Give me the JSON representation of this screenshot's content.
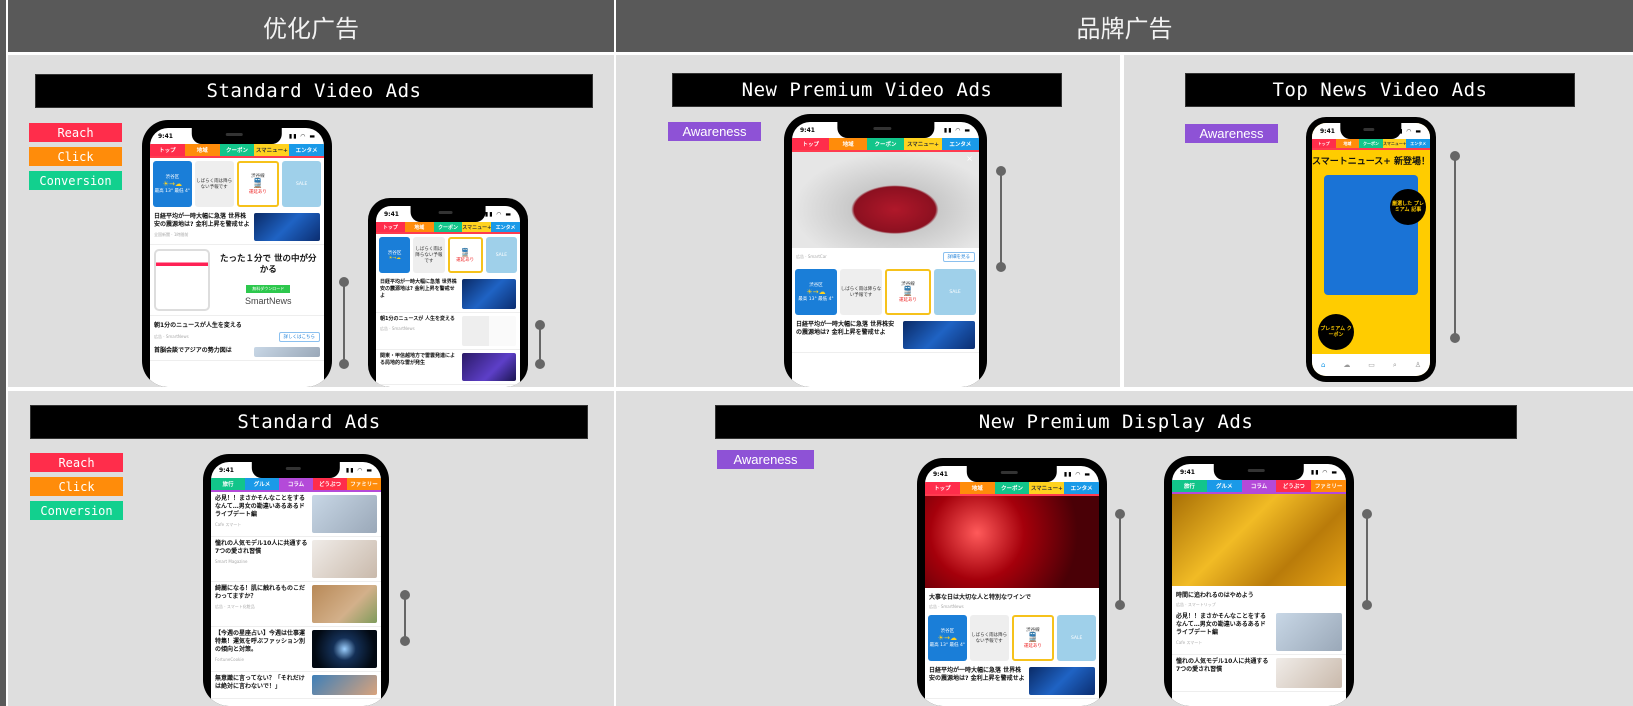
{
  "headers": {
    "optimized": "优化广告",
    "brand": "品牌广告"
  },
  "colors": {
    "reach": "#ff2d4b",
    "click": "#ff8c0a",
    "conversion": "#12d08e",
    "awareness": "#8e52d6",
    "header_bg": "#595959",
    "panel_bg": "#dedede"
  },
  "badges": {
    "reach": "Reach",
    "click": "Click",
    "conversion": "Conversion",
    "awareness": "Awareness"
  },
  "sections": {
    "standard_video": {
      "title": "Standard Video Ads"
    },
    "new_premium_video": {
      "title": "New Premium Video Ads"
    },
    "top_news_video": {
      "title": "Top News Video Ads"
    },
    "standard": {
      "title": "Standard Ads"
    },
    "new_premium_display": {
      "title": "New Premium Display Ads"
    }
  },
  "phone": {
    "time": "9:41",
    "status_icons": "▮▮ ◠ ▬",
    "tabs_main": [
      "トップ",
      "地域",
      "クーポン",
      "スマニュー+",
      "エンタメ"
    ],
    "tabs_alt": [
      "旅行",
      "グルメ",
      "コラム",
      "どうぶつ",
      "ファミリー"
    ],
    "cards": {
      "weather_area": "渋谷区",
      "weather_icon": "☀→☁",
      "weather_temps": "最高 13° 最低 4°",
      "map_text": "しばらく雨は降らない予報です",
      "train_station": "渋谷線",
      "train_icon": "🚆",
      "train_status": "運延あり",
      "shoes_text": "SALE"
    },
    "news": {
      "nikkei": "日経平均が一時大幅に急落 世界株安の震源地は? 金利上昇を警戒せよ",
      "nikkei_src": "全国新聞 · 1時間前",
      "one_min": "朝1分のニュースが人生を変える",
      "one_min_src": "広告 · SmartNews",
      "summit": "首脳会談でアジアの勢力図は",
      "storm": "関東・甲信越地方で雷雲発達による局地的な雷が発生",
      "one_min_short": "朝1分のニュースが 人生を変える",
      "drive": "必見！！まさかそんなことをするなんて…男女の勘違いあるあるドライブデート編",
      "drive_src": "Cafe スマート",
      "model": "憧れの人気モデル10人に共通する7つの愛され習慣",
      "model_src": "Smart Magazine",
      "skin": "綺麗になる！肌に触れるものこだわってますか？",
      "skin_src": "広告 · スマート化粧品",
      "horoscope": "【今週の星座占い】今週は仕事運特集！運気を呼ぶファッション別の傾向と対策。",
      "horoscope_src": "FortuneCookie",
      "unconscious": "無意識に言ってない？「それだけは絶対に言わないで！」",
      "wine": "大事な日は大切な人と特別なワインで",
      "wine_src": "広告 · SmartNews",
      "time_chase": "時間に追われるのはやめよう",
      "time_chase_src": "広告 · スマートリップ"
    },
    "hero": {
      "title": "たった１分で 世の中が分かる",
      "button": "無料ダウンロード",
      "brand": "SmartNews",
      "cta": "詳しくはこちら"
    },
    "car": {
      "src": "広告 · SmartCar",
      "cta": "詳細を見る",
      "close": "×"
    },
    "top_news": {
      "title": "スマートニュース+ 新登場！",
      "circle1": "厳選した プレミアム 記事",
      "circle2": "プレミアム クーポン",
      "bottom_icons": [
        "⌂",
        "☁",
        "▭",
        "⌕",
        "♙"
      ]
    }
  }
}
